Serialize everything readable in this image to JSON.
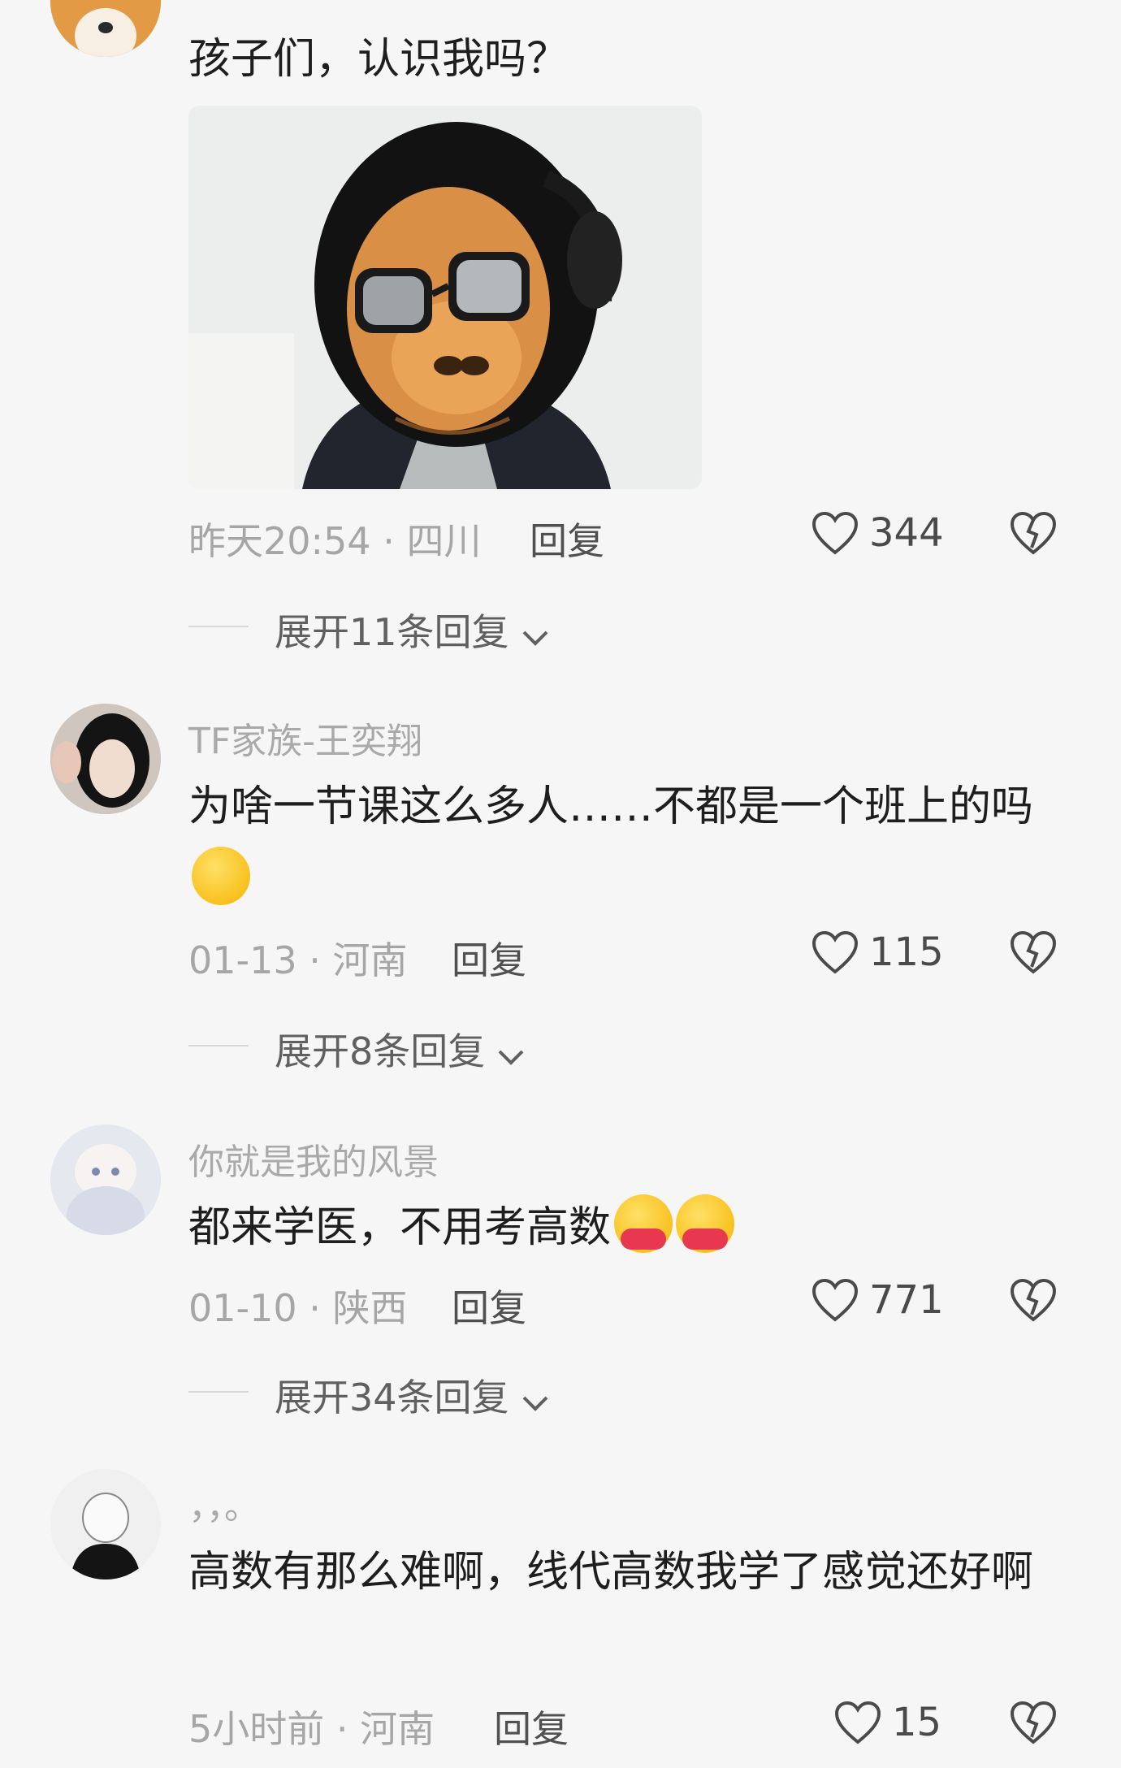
{
  "comments": [
    {
      "username": "",
      "text": "孩子们，认识我吗？",
      "time": "昨天20:54",
      "location": "四川",
      "reply_label": "回复",
      "likes": "344",
      "expand_label": "展开11条回复"
    },
    {
      "username": "TF家族-王奕翔",
      "text": "为啥一节课这么多人……不都是一个班上的吗",
      "time": "01-13",
      "location": "河南",
      "reply_label": "回复",
      "likes": "115",
      "expand_label": "展开8条回复"
    },
    {
      "username": "你就是我的风景",
      "text": "都来学医，不用考高数",
      "time": "01-10",
      "location": "陕西",
      "reply_label": "回复",
      "likes": "771",
      "expand_label": "展开34条回复"
    },
    {
      "username": "，，。",
      "text": "高数有那么难啊，线代高数我学了感觉还好啊",
      "time": "5小时前",
      "location": "河南",
      "reply_label": "回复",
      "likes": "15",
      "expand_label": ""
    }
  ],
  "separator": " · ",
  "colors": {
    "background": "#f6f6f6",
    "meta": "#a6a6a6",
    "text": "#1e1e1e"
  },
  "icons": [
    "heart-outline-icon",
    "broken-heart-icon",
    "chevron-down-icon"
  ]
}
